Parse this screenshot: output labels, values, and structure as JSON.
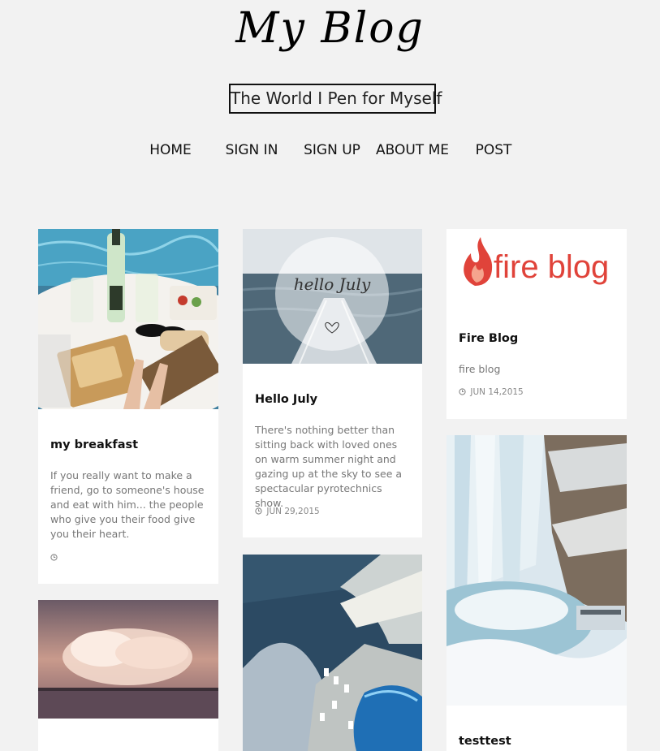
{
  "header": {
    "logo": "My Blog",
    "tagline": "The World I Pen for Myself"
  },
  "nav": {
    "items": [
      "HOME",
      "SIGN IN",
      "SIGN UP",
      "ABOUT ME",
      "POST"
    ]
  },
  "posts": [
    {
      "title": "my breakfast",
      "excerpt": "If you really want to make a friend, go to someone's house and eat with him... the people who give you their food give you their heart.",
      "date": "",
      "image": "breakfast-photo"
    },
    {
      "title": "Hello July",
      "excerpt": "There's nothing better than sitting back with loved ones on warm summer night and gazing up at the sky to see a spectacular pyrotechnics show.",
      "date": "JUN 29,2015",
      "image": "hello-july-photo",
      "image_text": "hello July"
    },
    {
      "title": "Fire Blog",
      "excerpt": "fire blog",
      "date": "JUN 14,2015",
      "image": "fire-blog-logo",
      "image_text": "fire blog"
    },
    {
      "title": "testtest",
      "image": "waterfall-photo"
    },
    {
      "title": "",
      "image": "cloud-sunset-photo"
    },
    {
      "title": "",
      "image": "coast-pool-aerial-photo"
    }
  ],
  "colors": {
    "background": "#f2f2f2",
    "card": "#ffffff",
    "text_muted": "#777777",
    "fire_red": "#d8393a"
  }
}
